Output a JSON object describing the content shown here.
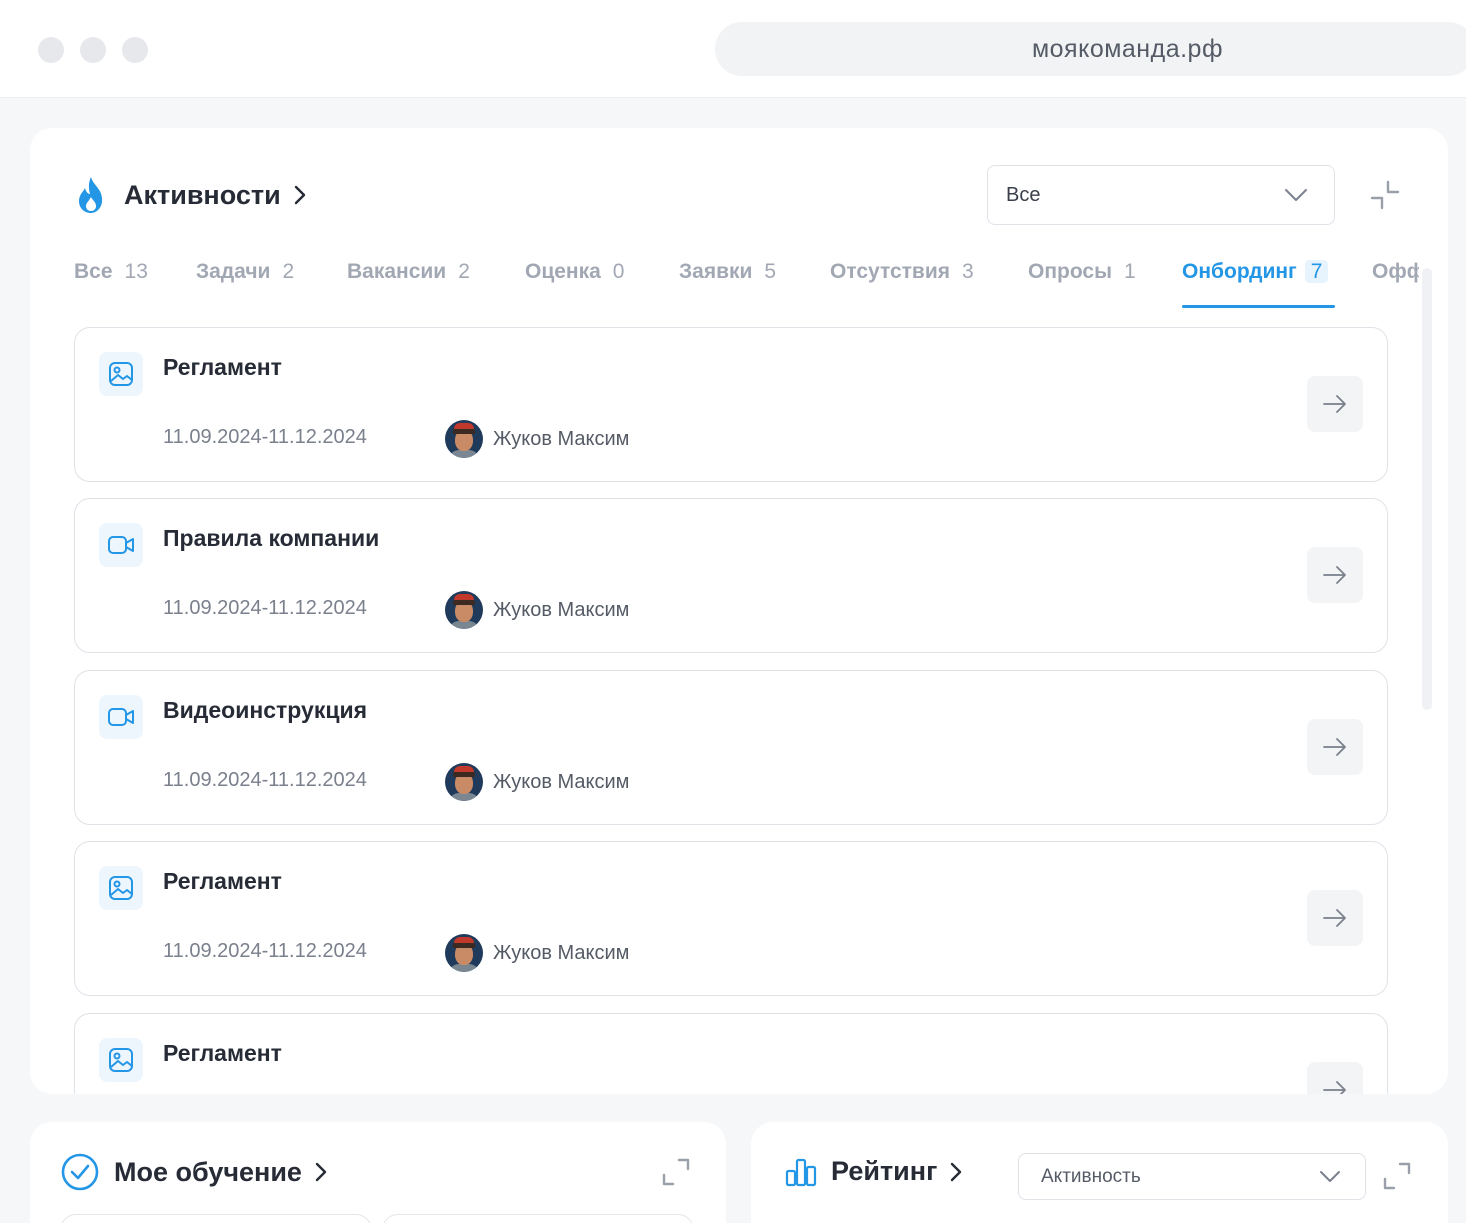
{
  "browser": {
    "url": "моякоманда.рф"
  },
  "activities": {
    "title": "Активности",
    "filter": {
      "selected": "Все"
    },
    "tabs": [
      {
        "label": "Все",
        "count": "13"
      },
      {
        "label": "Задачи",
        "count": "2"
      },
      {
        "label": "Вакансии",
        "count": "2"
      },
      {
        "label": "Оценка",
        "count": "0"
      },
      {
        "label": "Заявки",
        "count": "5"
      },
      {
        "label": "Отсутствия",
        "count": "3"
      },
      {
        "label": "Опросы",
        "count": "1"
      },
      {
        "label": "Онбординг",
        "count": "7",
        "active": true
      },
      {
        "label": "Офф",
        "count": ""
      }
    ],
    "cards": [
      {
        "type": "image-icon",
        "title": "Регламент",
        "date": "11.09.2024-11.12.2024",
        "person": "Жуков Максим"
      },
      {
        "type": "video-icon",
        "title": "Правила компании",
        "date": "11.09.2024-11.12.2024",
        "person": "Жуков Максим"
      },
      {
        "type": "video-icon",
        "title": "Видеоинструкция",
        "date": "11.09.2024-11.12.2024",
        "person": "Жуков Максим"
      },
      {
        "type": "image-icon",
        "title": "Регламент",
        "date": "11.09.2024-11.12.2024",
        "person": "Жуков Максим"
      },
      {
        "type": "image-icon",
        "title": "Регламент",
        "date": "",
        "person": ""
      }
    ]
  },
  "learning": {
    "title": "Мое обучение"
  },
  "rating": {
    "title": "Рейтинг",
    "filter": {
      "selected": "Активность"
    }
  },
  "colors": {
    "accent": "#2496e6",
    "text": "#262b36",
    "muted": "#a2a8b3",
    "border": "#dfe2e7"
  }
}
